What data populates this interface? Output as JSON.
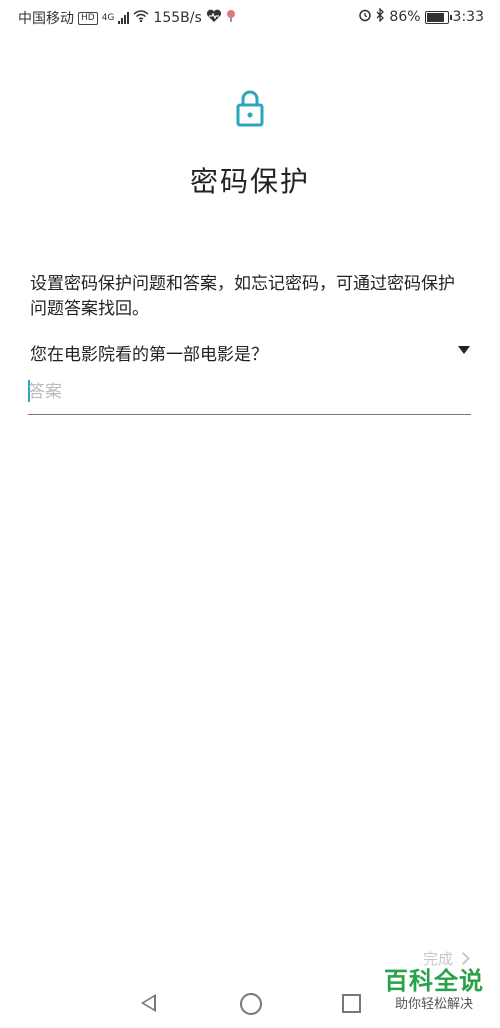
{
  "status_bar": {
    "carrier": "中国移动",
    "hd": "HD",
    "network": "4G",
    "speed": "155B/s",
    "battery_text": "86%",
    "battery_level": 0.86,
    "time": "3:33"
  },
  "page": {
    "title": "密码保护",
    "description": "设置密码保护问题和答案，如忘记密码，可通过密码保护问题答案找回。",
    "question": "您在电影院看的第一部电影是？",
    "answer_placeholder": "答案",
    "answer_value": "",
    "done_label": "完成"
  },
  "watermark": {
    "title": "百科全说",
    "subtitle": "助你轻松解决"
  },
  "colors": {
    "accent": "#2aa7b8",
    "watermark": "#2aa04b"
  }
}
